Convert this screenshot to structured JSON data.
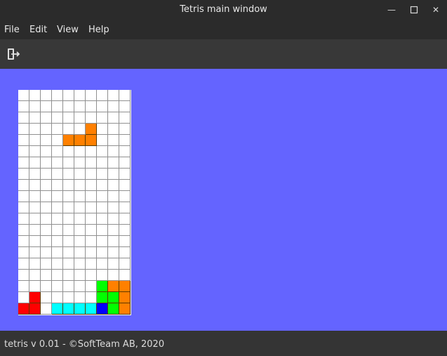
{
  "window": {
    "title": "Tetris main window",
    "background": "#6464ff"
  },
  "window_controls": {
    "minimize_icon": "minimize-icon",
    "maximize_icon": "maximize-icon",
    "close_icon": "close-icon"
  },
  "menu": {
    "items": [
      {
        "label": "File"
      },
      {
        "label": "Edit"
      },
      {
        "label": "View"
      },
      {
        "label": "Help"
      }
    ]
  },
  "toolbar": {
    "exit_icon": "exit-icon"
  },
  "board": {
    "columns": 10,
    "rows": 20,
    "empty_color": "#ffffff",
    "grid_color": "#909090",
    "block_border_color": "#5a3a00",
    "cells": [
      {
        "row": 3,
        "col": 6,
        "color": "#ff8000"
      },
      {
        "row": 4,
        "col": 4,
        "color": "#ff8000"
      },
      {
        "row": 4,
        "col": 5,
        "color": "#ff8000"
      },
      {
        "row": 4,
        "col": 6,
        "color": "#ff8000"
      },
      {
        "row": 17,
        "col": 7,
        "color": "#00ff00"
      },
      {
        "row": 17,
        "col": 8,
        "color": "#ff8000"
      },
      {
        "row": 17,
        "col": 9,
        "color": "#ff8000"
      },
      {
        "row": 18,
        "col": 1,
        "color": "#ff0000"
      },
      {
        "row": 18,
        "col": 7,
        "color": "#00ff00"
      },
      {
        "row": 18,
        "col": 8,
        "color": "#00ff00"
      },
      {
        "row": 18,
        "col": 9,
        "color": "#ff8000"
      },
      {
        "row": 19,
        "col": 0,
        "color": "#ff0000"
      },
      {
        "row": 19,
        "col": 1,
        "color": "#ff0000"
      },
      {
        "row": 19,
        "col": 3,
        "color": "#00ffff"
      },
      {
        "row": 19,
        "col": 4,
        "color": "#00ffff"
      },
      {
        "row": 19,
        "col": 5,
        "color": "#00ffff"
      },
      {
        "row": 19,
        "col": 6,
        "color": "#00ffff"
      },
      {
        "row": 19,
        "col": 7,
        "color": "#0000ff"
      },
      {
        "row": 19,
        "col": 8,
        "color": "#00ff00"
      },
      {
        "row": 19,
        "col": 9,
        "color": "#ff8000"
      }
    ]
  },
  "status": {
    "text": "tetris v 0.01 - ©SoftTeam AB, 2020"
  }
}
